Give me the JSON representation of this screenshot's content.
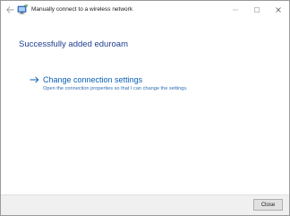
{
  "window": {
    "title": "Manually connect to a wireless network"
  },
  "main": {
    "heading": "Successfully added eduroam",
    "link": {
      "title": "Change connection settings",
      "description": "Open the connection properties so that I can change the settings."
    }
  },
  "footer": {
    "close_label": "Close"
  },
  "colors": {
    "heading": "#1e3d8f",
    "link": "#0a5fb5",
    "footer_bg": "#f0f0f0"
  },
  "icons": {
    "back": "back-arrow-icon",
    "app": "wireless-network-icon",
    "minimize": "minimize-icon",
    "maximize": "maximize-icon",
    "close": "close-icon",
    "link_arrow": "right-arrow-icon"
  }
}
